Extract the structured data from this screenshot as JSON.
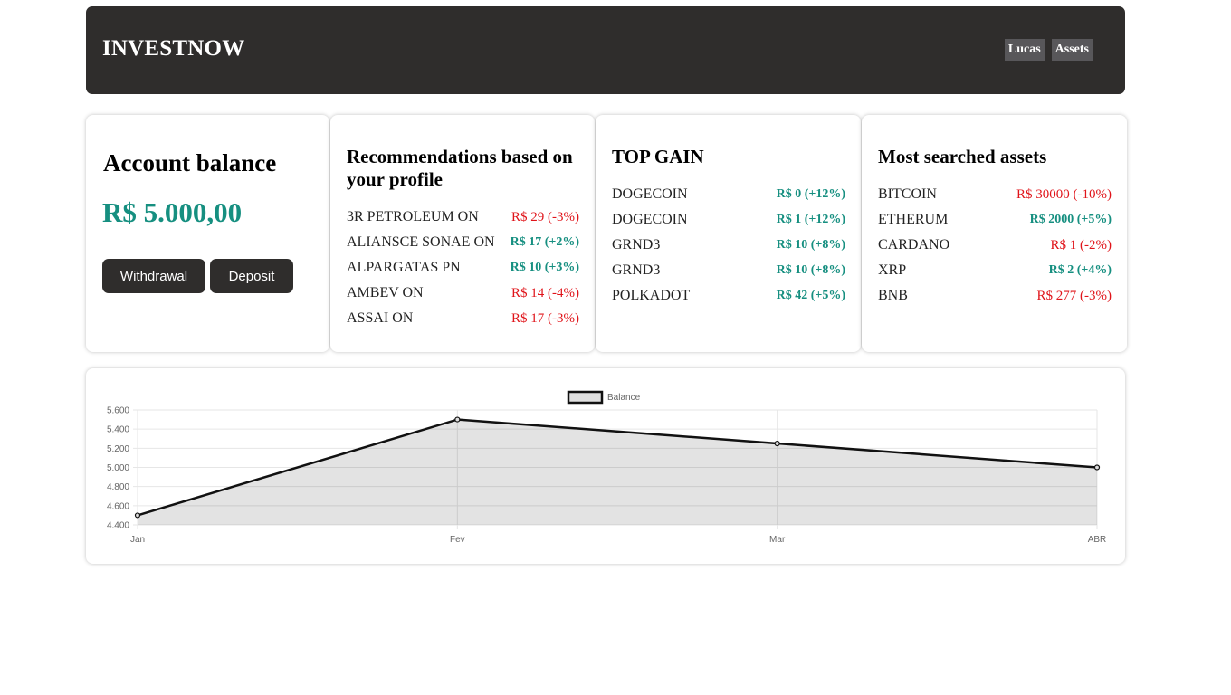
{
  "header": {
    "brand": "INVESTNOW",
    "nav": [
      "Lucas",
      "Assets"
    ]
  },
  "balance_card": {
    "title": "Account balance",
    "amount": "R$ 5.000,00",
    "withdrawal_label": "Withdrawal",
    "deposit_label": "Deposit"
  },
  "recommendations": {
    "title": "Recommendations based on your profile",
    "items": [
      {
        "name": "3R PETROLEUM ON",
        "value": "R$ 29 (-3%)",
        "trend": "down"
      },
      {
        "name": "ALIANSCE SONAE ON",
        "value": "R$ 17 (+2%)",
        "trend": "up"
      },
      {
        "name": "ALPARGATAS PN",
        "value": "R$ 10 (+3%)",
        "trend": "up"
      },
      {
        "name": "AMBEV ON",
        "value": "R$ 14 (-4%)",
        "trend": "down"
      },
      {
        "name": "ASSAI ON",
        "value": "R$ 17 (-3%)",
        "trend": "down"
      }
    ]
  },
  "top_gain": {
    "title": "TOP GAIN",
    "items": [
      {
        "name": "DOGECOIN",
        "value": "R$ 0 (+12%)",
        "trend": "up"
      },
      {
        "name": "DOGECOIN",
        "value": "R$ 1 (+12%)",
        "trend": "up"
      },
      {
        "name": "GRND3",
        "value": "R$ 10 (+8%)",
        "trend": "up"
      },
      {
        "name": "GRND3",
        "value": "R$ 10 (+8%)",
        "trend": "up"
      },
      {
        "name": "POLKADOT",
        "value": "R$ 42 (+5%)",
        "trend": "up"
      }
    ]
  },
  "most_searched": {
    "title": "Most searched assets",
    "items": [
      {
        "name": "BITCOIN",
        "value": "R$ 30000 (-10%)",
        "trend": "down"
      },
      {
        "name": "ETHERUM",
        "value": "R$ 2000 (+5%)",
        "trend": "up"
      },
      {
        "name": "CARDANO",
        "value": "R$ 1 (-2%)",
        "trend": "down"
      },
      {
        "name": "XRP",
        "value": "R$ 2 (+4%)",
        "trend": "up"
      },
      {
        "name": "BNB",
        "value": "R$ 277 (-3%)",
        "trend": "down"
      }
    ]
  },
  "colors": {
    "up": "#168f80",
    "down": "#e0141a",
    "header_bg": "#2f2d2c"
  },
  "chart_data": {
    "type": "area",
    "categories": [
      "Jan",
      "Fev",
      "Mar",
      "ABR"
    ],
    "series": [
      {
        "name": "Balance",
        "values": [
          4500,
          5500,
          5250,
          5000
        ]
      }
    ],
    "ylim": [
      4400,
      5600
    ],
    "yticks": [
      "5.600",
      "5.400",
      "5.200",
      "5.000",
      "4.800",
      "4.600",
      "4.400"
    ],
    "ytick_values": [
      5600,
      5400,
      5200,
      5000,
      4800,
      4600,
      4400
    ],
    "legend": "top",
    "grid": true
  }
}
